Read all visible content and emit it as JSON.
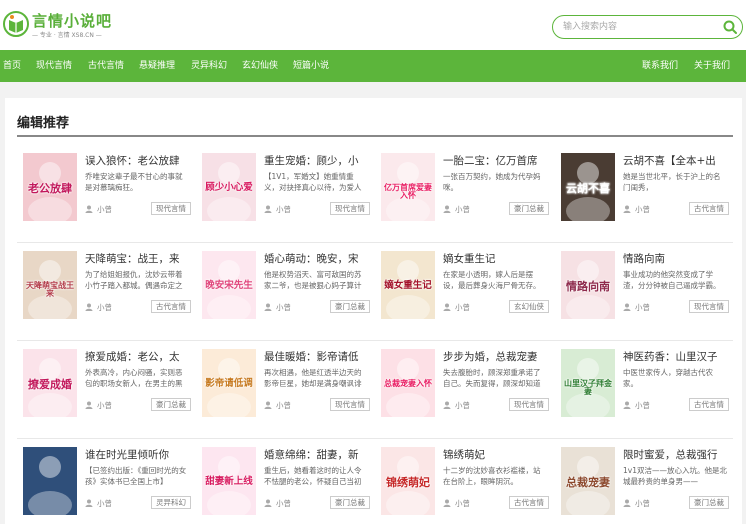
{
  "header": {
    "logo_title": "言情小说吧",
    "logo_sub": "— 专业 · 言情  XS8.CN —",
    "search_placeholder": "输入搜索内容"
  },
  "nav": {
    "left": [
      "首页",
      "现代言情",
      "古代言情",
      "悬疑推理",
      "灵异科幻",
      "玄幻仙侠",
      "短篇小说"
    ],
    "right": [
      "联系我们",
      "关于我们"
    ]
  },
  "section_title": "编辑推荐",
  "books": [
    {
      "title": "误入狼怀：老公放肆",
      "desc": "乔唯安这辈子最不甘心的事就是对慕璃痴狂。",
      "author": "小曾",
      "tag": "现代言情",
      "cover_text": "老公放肆",
      "cover_bg": "#f3c9cf",
      "cover_fg": "#c2185b"
    },
    {
      "title": "重生宠婚：顾少，小",
      "desc": "【1V1，军婚文】她重情重义，对抉择真心以待，为爱人",
      "author": "小曾",
      "tag": "现代言情",
      "cover_text": "顾少小心爱",
      "cover_bg": "#f7e0e6",
      "cover_fg": "#d81b60"
    },
    {
      "title": "一胎二宝：亿万首席",
      "desc": "一张百万契约，她成为代孕妈咪。",
      "author": "小曾",
      "tag": "豪门总裁",
      "cover_text": "亿万首席爱妻入怀",
      "cover_bg": "#fbe9ec",
      "cover_fg": "#e91e63"
    },
    {
      "title": "云胡不喜【全本+出",
      "desc": "她是当世北平，长于沪上的名门闺秀，",
      "author": "小曾",
      "tag": "古代言情",
      "cover_text": "云胡不喜",
      "cover_bg": "#4a3c33",
      "cover_fg": "#ffffff"
    },
    {
      "title": "天降萌宝：战王，来",
      "desc": "为了给姐姐报仇，沈妙云带着小竹子踏入都城。偶遇命定之",
      "author": "小曾",
      "tag": "古代言情",
      "cover_text": "天降萌宝战王来",
      "cover_bg": "#e8d7c6",
      "cover_fg": "#b23a48"
    },
    {
      "title": "婚心萌动：晚安，宋",
      "desc": "他是权势滔天、富可敌国的苏家二爷，也是被狠心妈子算计",
      "author": "小曾",
      "tag": "豪门总裁",
      "cover_text": "晚安宋先生",
      "cover_bg": "#fde7ef",
      "cover_fg": "#e0457b"
    },
    {
      "title": "嫡女重生记",
      "desc": "在家是小透明，嫁人后是摆设，最后葬身火海尸骨无存。",
      "author": "小曾",
      "tag": "玄幻仙侠",
      "cover_text": "嫡女重生记",
      "cover_bg": "#f3e6cf",
      "cover_fg": "#a3122a"
    },
    {
      "title": "情路向南",
      "desc": "事业成功的他突然变成了学渣，分分钟被自己逼成学霸。",
      "author": "小曾",
      "tag": "现代言情",
      "cover_text": "情路向南",
      "cover_bg": "#f6e1e4",
      "cover_fg": "#8e2a4c"
    },
    {
      "title": "撩爱成婚：老公，太",
      "desc": "外表高冷，内心闷骚，实则恶包的职场女新人，在男主的黑",
      "author": "小曾",
      "tag": "豪门总裁",
      "cover_text": "撩爱成婚",
      "cover_bg": "#fbe3ea",
      "cover_fg": "#c2185b"
    },
    {
      "title": "最佳暖婚：影帝请低",
      "desc": "再次相遇，他是红透半边天的影帝巨星，她却是满身嘲讽诽",
      "author": "小曾",
      "tag": "现代言情",
      "cover_text": "影帝请低调",
      "cover_bg": "#fcebd8",
      "cover_fg": "#c77a20"
    },
    {
      "title": "步步为婚，总裁宠妻",
      "desc": "失去腹胎时，顾深郑重承诺了自己。失而复得，顾深却知道",
      "author": "小曾",
      "tag": "现代言情",
      "cover_text": "总裁宠妻入怀",
      "cover_bg": "#fde0e6",
      "cover_fg": "#e91e63"
    },
    {
      "title": "神医药香：山里汉子",
      "desc": "中医世家传人，穿越古代农家。",
      "author": "小曾",
      "tag": "古代言情",
      "cover_text": "山里汉子拜金妻",
      "cover_bg": "#d8ecd4",
      "cover_fg": "#2e7d32"
    },
    {
      "title": "谁在时光里倾听你",
      "desc": "【已签约出版：《重回时光的女孩》实体书已全国上市】",
      "author": "小曾",
      "tag": "灵异科幻",
      "cover_text": "",
      "cover_bg": "#2f4f7a",
      "cover_fg": "#ffffff"
    },
    {
      "title": "婚意绵绵：甜妻，新",
      "desc": "重生后，她看着这时的让人令不怯腿的老公，怀疑自己当初",
      "author": "小曾",
      "tag": "豪门总裁",
      "cover_text": "甜妻新上线",
      "cover_bg": "#fde6f0",
      "cover_fg": "#d81b60"
    },
    {
      "title": "锦绣萌妃",
      "desc": "十二岁的沈妙喜衣衫褴褛，站在台阶上，眼眸阴沉。",
      "author": "小曾",
      "tag": "古代言情",
      "cover_text": "锦绣萌妃",
      "cover_bg": "#fbe6e6",
      "cover_fg": "#c62828"
    },
    {
      "title": "限时蜜爱，总裁强行",
      "desc": "1v1双洁——放心入坑。他是北城最矜贵的单身男——",
      "author": "小曾",
      "tag": "豪门总裁",
      "cover_text": "总裁宠妻",
      "cover_bg": "#e9e1d6",
      "cover_fg": "#8d4a2f"
    }
  ],
  "colors": {
    "brand_green": "#5cb53b",
    "nav_text": "#ffffff"
  }
}
